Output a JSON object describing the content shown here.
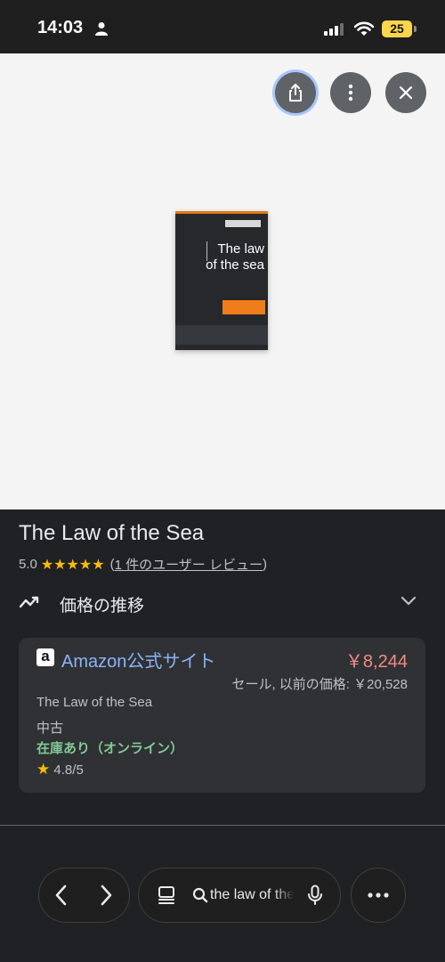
{
  "status_bar": {
    "time": "14:03",
    "battery": "25"
  },
  "viewer": {
    "book_cover": {
      "line1": "The law",
      "line2": "of the sea"
    }
  },
  "product": {
    "title": "The Law of the Sea",
    "rating_value": "5.0",
    "stars": "★★★★★",
    "review_open": "(",
    "review_link": "1 件のユーザー レビュー",
    "review_close": ")"
  },
  "price_trend": {
    "label": "価格の推移"
  },
  "offer": {
    "logo_letter": "a",
    "seller": "Amazon公式サイト",
    "price": "￥8,244",
    "sale_note": "セール, 以前の価格: ￥20,528",
    "product_title": "The Law of the Sea",
    "condition": "中古",
    "stock": "在庫あり（オンライン）",
    "rating_star": "★",
    "rating": "4.8/5"
  },
  "toolbar": {
    "search_query": "the law of the sea"
  },
  "colors": {
    "accent_link": "#8ab4f8",
    "price": "#f28b82",
    "in_stock": "#81c995",
    "star": "#fbbc04"
  },
  "icons": [
    "person-icon",
    "signal-icon",
    "wifi-icon",
    "share-icon",
    "more-vert-icon",
    "close-icon",
    "trend-icon",
    "chevron-down-icon",
    "back-icon",
    "forward-icon",
    "tabs-icon",
    "search-icon",
    "mic-icon",
    "more-horiz-icon"
  ]
}
